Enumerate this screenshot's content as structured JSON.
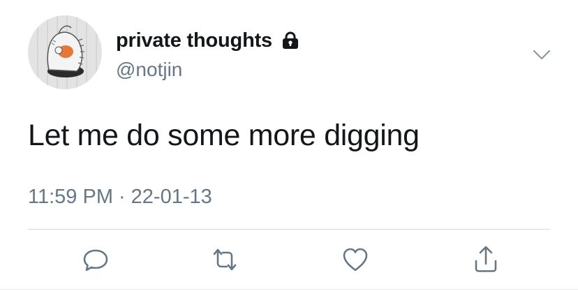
{
  "tweet": {
    "author": {
      "display_name": "private thoughts",
      "handle": "@notjin",
      "protected_icon": "lock-icon",
      "avatar": "cartoon-character-avatar"
    },
    "menu_icon": "chevron-down-icon",
    "text": "Let me do some more digging",
    "time": "11:59 PM",
    "separator": "·",
    "date": "22-01-13"
  },
  "actions": [
    {
      "name": "reply",
      "icon": "reply-icon"
    },
    {
      "name": "retweet",
      "icon": "retweet-icon"
    },
    {
      "name": "like",
      "icon": "heart-icon"
    },
    {
      "name": "share",
      "icon": "share-icon"
    }
  ],
  "colors": {
    "text": "#14171a",
    "secondary": "#657786",
    "icon": "#657786",
    "divider": "#cfd9de",
    "avatar_bg": "#e3e3e3"
  }
}
